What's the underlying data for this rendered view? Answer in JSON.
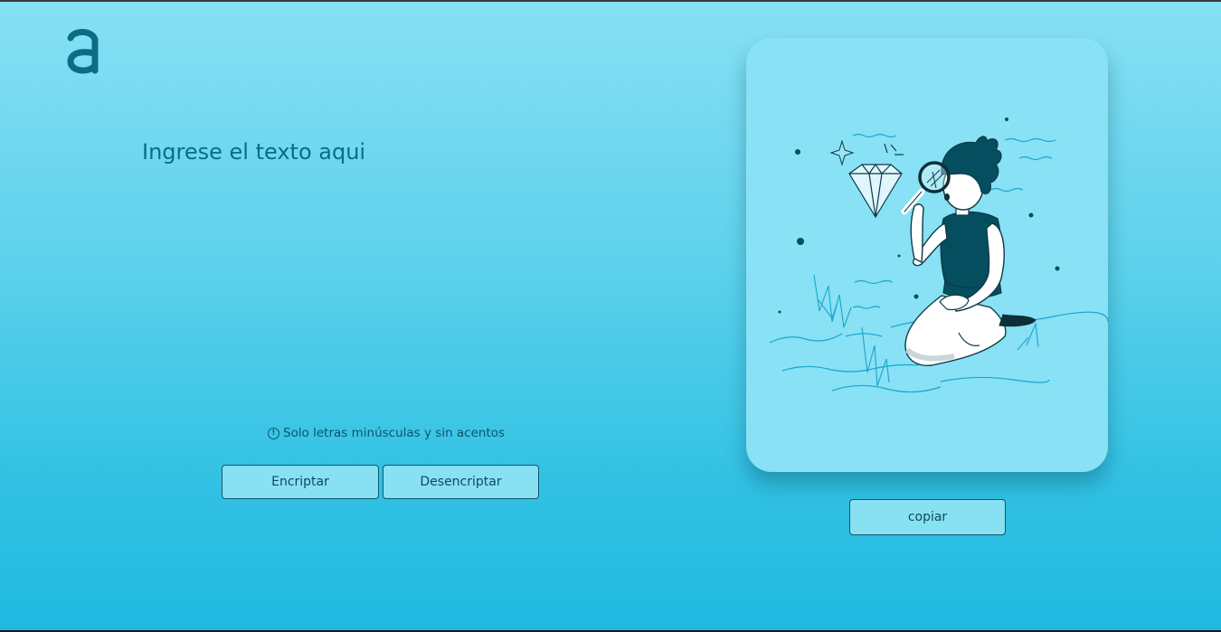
{
  "logo": {
    "glyph": "a",
    "color": "#0a6d86"
  },
  "input": {
    "placeholder": "Ingrese el texto aqui",
    "value": ""
  },
  "hint": {
    "icon": "info-icon",
    "text": "Solo letras minúsculas y sin acentos"
  },
  "buttons": {
    "encrypt_label": "Encriptar",
    "decrypt_label": "Desencriptar",
    "copy_label": "copiar"
  },
  "illustration": {
    "subject": "person-with-magnifying-glass-examining-diamond"
  },
  "colors": {
    "accent": "#0a6d86",
    "button_bg": "#88e1f3",
    "card_bg": "#88e1f4",
    "figure_dark": "#054e5f"
  }
}
